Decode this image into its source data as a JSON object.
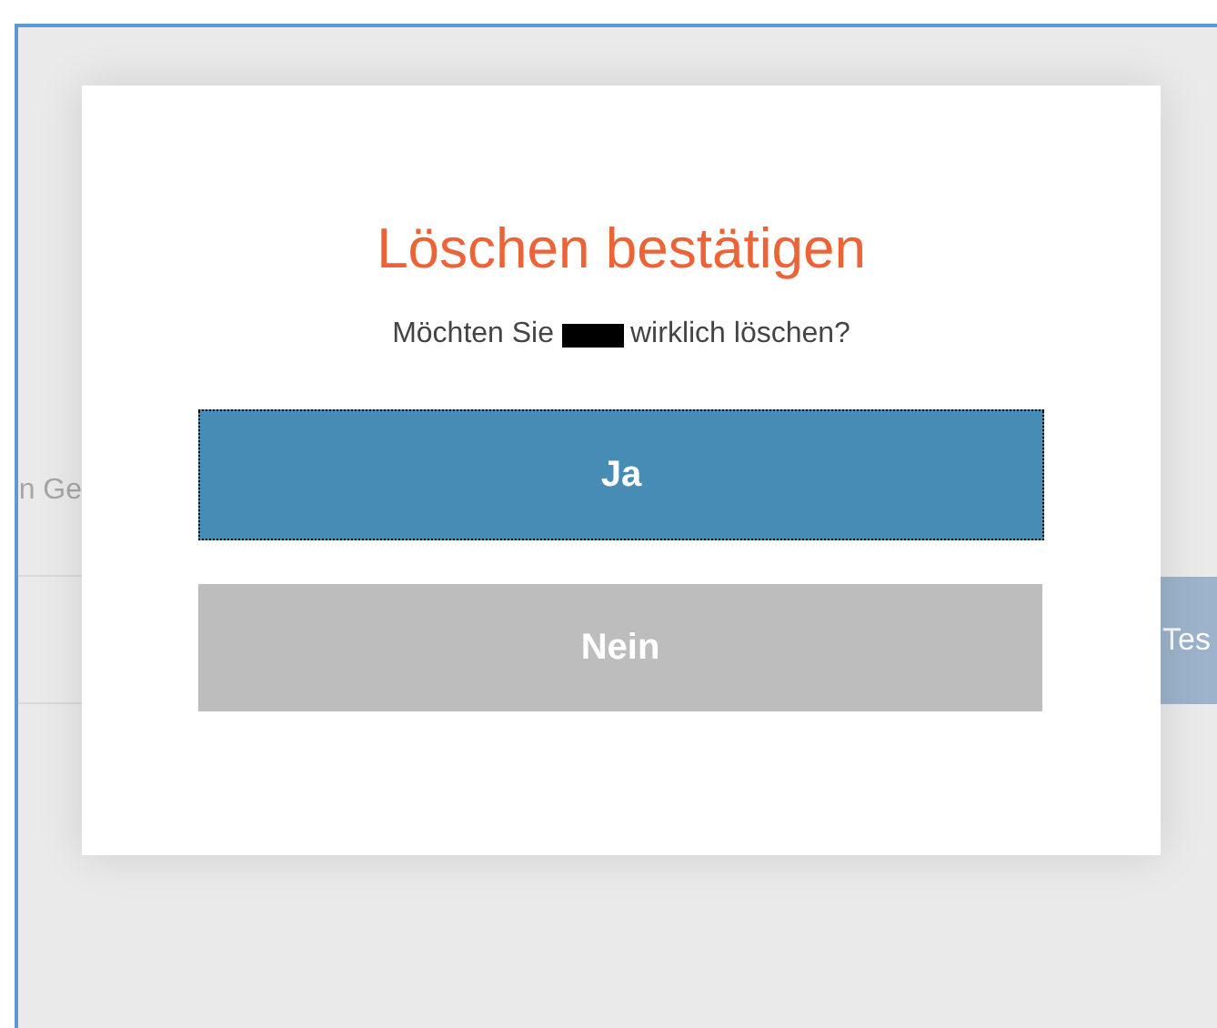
{
  "background": {
    "label_fragment": "n Ge",
    "button_fragment": "Tes"
  },
  "dialog": {
    "title": "Löschen bestätigen",
    "message_before": "Möchten Sie",
    "message_after": "wirklich löschen?",
    "redacted": true,
    "buttons": [
      {
        "label": "Ja",
        "kind": "primary",
        "focused": true
      },
      {
        "label": "Nein",
        "kind": "secondary",
        "focused": false
      }
    ]
  }
}
